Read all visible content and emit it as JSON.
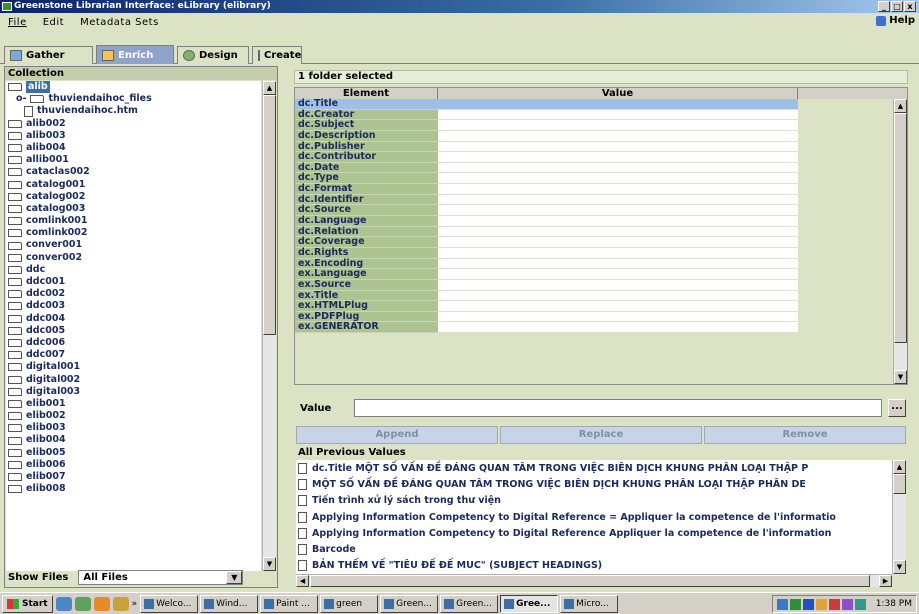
{
  "window": {
    "title": "Greenstone Librarian Interface: eLibrary (elibrary)",
    "controls": [
      "_",
      "□",
      "x"
    ]
  },
  "menu": {
    "items": [
      "File",
      "Edit",
      "Metadata Sets"
    ],
    "help": "Help"
  },
  "tabs": [
    "Gather",
    "Enrich",
    "Design",
    "Create"
  ],
  "collection": {
    "header": "Collection",
    "tree": [
      {
        "label": "alib",
        "type": "folder",
        "level": 0,
        "selected": true
      },
      {
        "label": "thuviendaihoc_files",
        "type": "folder",
        "level": 1,
        "expand": "o-"
      },
      {
        "label": "thuviendaihoc.htm",
        "type": "file",
        "level": 2
      },
      {
        "label": "alib002",
        "type": "folder",
        "level": 0
      },
      {
        "label": "alib003",
        "type": "folder",
        "level": 0
      },
      {
        "label": "alib004",
        "type": "folder",
        "level": 0
      },
      {
        "label": "allib001",
        "type": "folder",
        "level": 0
      },
      {
        "label": "cataclas002",
        "type": "folder",
        "level": 0
      },
      {
        "label": "catalog001",
        "type": "folder",
        "level": 0
      },
      {
        "label": "catalog002",
        "type": "folder",
        "level": 0
      },
      {
        "label": "catalog003",
        "type": "folder",
        "level": 0
      },
      {
        "label": "comlink001",
        "type": "folder",
        "level": 0
      },
      {
        "label": "comlink002",
        "type": "folder",
        "level": 0
      },
      {
        "label": "conver001",
        "type": "folder",
        "level": 0
      },
      {
        "label": "conver002",
        "type": "folder",
        "level": 0
      },
      {
        "label": "ddc",
        "type": "folder",
        "level": 0
      },
      {
        "label": "ddc001",
        "type": "folder",
        "level": 0
      },
      {
        "label": "ddc002",
        "type": "folder",
        "level": 0
      },
      {
        "label": "ddc003",
        "type": "folder",
        "level": 0
      },
      {
        "label": "ddc004",
        "type": "folder",
        "level": 0
      },
      {
        "label": "ddc005",
        "type": "folder",
        "level": 0
      },
      {
        "label": "ddc006",
        "type": "folder",
        "level": 0
      },
      {
        "label": "ddc007",
        "type": "folder",
        "level": 0
      },
      {
        "label": "digital001",
        "type": "folder",
        "level": 0
      },
      {
        "label": "digital002",
        "type": "folder",
        "level": 0
      },
      {
        "label": "digital003",
        "type": "folder",
        "level": 0
      },
      {
        "label": "elib001",
        "type": "folder",
        "level": 0
      },
      {
        "label": "elib002",
        "type": "folder",
        "level": 0
      },
      {
        "label": "elib003",
        "type": "folder",
        "level": 0
      },
      {
        "label": "elib004",
        "type": "folder",
        "level": 0
      },
      {
        "label": "elib005",
        "type": "folder",
        "level": 0
      },
      {
        "label": "elib006",
        "type": "folder",
        "level": 0
      },
      {
        "label": "elib007",
        "type": "folder",
        "level": 0
      },
      {
        "label": "elib008",
        "type": "folder",
        "level": 0
      }
    ],
    "show_files_label": "Show Files",
    "show_files_value": "All Files"
  },
  "enrich": {
    "status": "1 folder selected",
    "columns": [
      "Element",
      "Value"
    ],
    "elements": [
      "dc.Title",
      "dc.Creator",
      "dc.Subject",
      "dc.Description",
      "dc.Publisher",
      "dc.Contributor",
      "dc.Date",
      "dc.Type",
      "dc.Format",
      "dc.Identifier",
      "dc.Source",
      "dc.Language",
      "dc.Relation",
      "dc.Coverage",
      "dc.Rights",
      "ex.Encoding",
      "ex.Language",
      "ex.Source",
      "ex.Title",
      "ex.HTMLPlug",
      "ex.PDFPlug",
      "ex.GENERATOR"
    ],
    "value_label": "Value",
    "value_input": "",
    "more_button": "...",
    "buttons": [
      "Append",
      "Replace",
      "Remove"
    ],
    "previous_header": "All Previous Values",
    "previous_values": [
      "dc.Title  MỘT SỐ VẤN ĐỀ ĐÁNG QUAN TÂM TRONG VIỆC BIÊN DỊCH  KHUNG PHÂN LOẠI THẬP P",
      "MỘT SỐ VẤN ĐỀ ĐÁNG QUAN TÂM TRONG VIỆC BIÊN DỊCH  KHUNG PHÂN LOẠI THẬP PHÂN DE",
      "Tiến trình xử lý sách trong thư viện",
      "Applying Information Competency to Digital Reference = Appliquer la competence de l'informatio",
      "Applying Information Competency to Digital Reference Appliquer la competence de l'information",
      "Barcode",
      "BẢN THẾM VẾ \"TIÊU ĐẾ ĐẾ MUC\" (SUBJECT HEADINGS)"
    ]
  },
  "taskbar": {
    "start": "Start",
    "quick_launch_extra": "»",
    "buttons": [
      "Welco...",
      "Wind...",
      "Paint ...",
      "green",
      "Green...",
      "Green...",
      "Gree...",
      "Micro..."
    ],
    "active_index": 6,
    "clock": "1:38 PM"
  }
}
